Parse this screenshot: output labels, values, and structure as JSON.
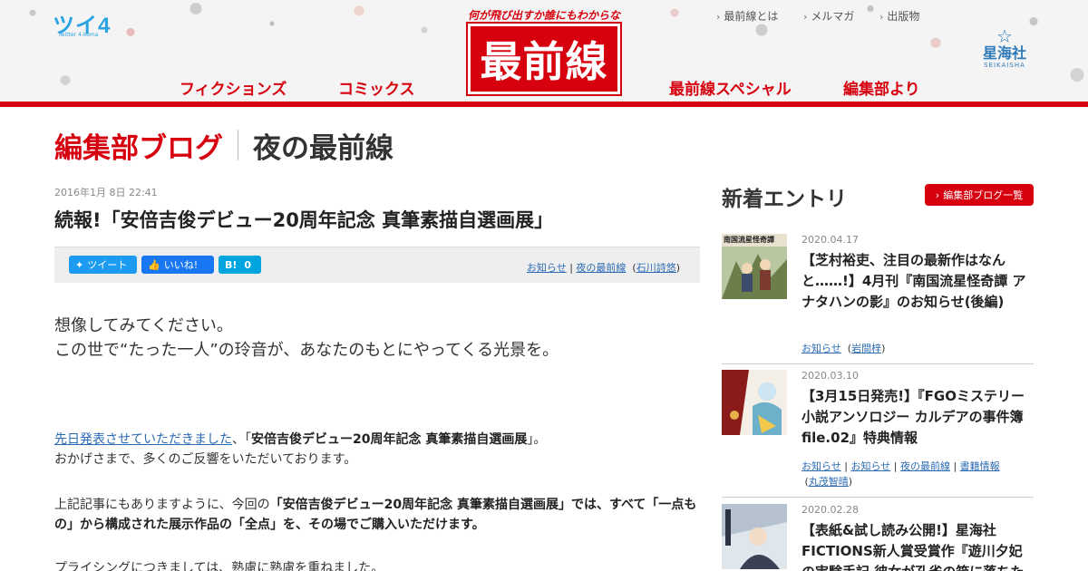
{
  "header": {
    "twi4_logo": "ツイ4",
    "twi4_sub": "Twitter 4-koma",
    "logo_tagline": "何が飛び出すか誰にもわからない!",
    "logo_text": "最前線",
    "nav_main": [
      "フィクションズ",
      "コミックス",
      "最前線スペシャル",
      "編集部より"
    ],
    "nav_top": [
      "最前線とは",
      "メルマガ",
      "出版物"
    ],
    "publisher_jp": "星海社",
    "publisher_en": "SEIKAISHA"
  },
  "page_title": {
    "primary": "編集部ブログ",
    "secondary": "夜の最前線"
  },
  "article": {
    "date": "2016年1月 8日 22:41",
    "title": "続報!「安倍吉俊デビュー20周年記念 真筆素描自選画展」",
    "share": {
      "tweet": "ツイート",
      "like": "いいね!",
      "hatena": "B!",
      "hatena_count": "0"
    },
    "categories": [
      "お知らせ",
      "夜の最前線"
    ],
    "author": "石川詩悠",
    "lead_1": "想像してみてください。",
    "lead_2": "この世で“たった一人”の玲音が、あなたのもとにやってくる光景を。",
    "p1_link": "先日発表させていただきました",
    "p1_mid": "、「",
    "p1_bold": "安倍吉俊デビュー20周年記念 真筆素描自選画展",
    "p1_end": "」。",
    "p1_line2": "おかげさまで、多くのご反響をいただいております。",
    "p2_a": "上記記事にもありますように、今回の",
    "p2_bold": "「安倍吉俊デビュー20周年記念 真筆素描自選画展」では、すべて「一点もの」から構成された展示作品の「全点」を、その場でご購入いただけます。",
    "p3": "プライシングにつきましては、熟慮に熟慮を重ねました。"
  },
  "sidebar": {
    "heading": "新着エントリ",
    "list_button": "編集部ブログ一覧",
    "entries": [
      {
        "date": "2020.04.17",
        "title": "【芝村裕吏、注目の最新作はなんと……!】4月刊『南国流星怪奇譚 アナタハンの影』のお知らせ(後編)",
        "tags": [
          "お知らせ"
        ],
        "author": "岩間梓",
        "thumb_text": "南国流星怪奇譚"
      },
      {
        "date": "2020.03.10",
        "title": "【3月15日発売!】『FGOミステリー小説アンソロジー カルデアの事件簿 file.02』特典情報",
        "tags": [
          "お知らせ",
          "お知らせ",
          "夜の最前線",
          "書籍情報"
        ],
        "author": "丸茂智晴"
      },
      {
        "date": "2020.02.28",
        "title": "【表紙&試し読み公開!】星海社FICTIONS新人賞受賞作『遊川夕妃の実験手記 彼女が孔雀の箱に落ちた"
      }
    ]
  },
  "colors": {
    "brand_red": "#d7000f",
    "link_blue": "#2b6bb3",
    "twi4_blue": "#29a3e2"
  }
}
